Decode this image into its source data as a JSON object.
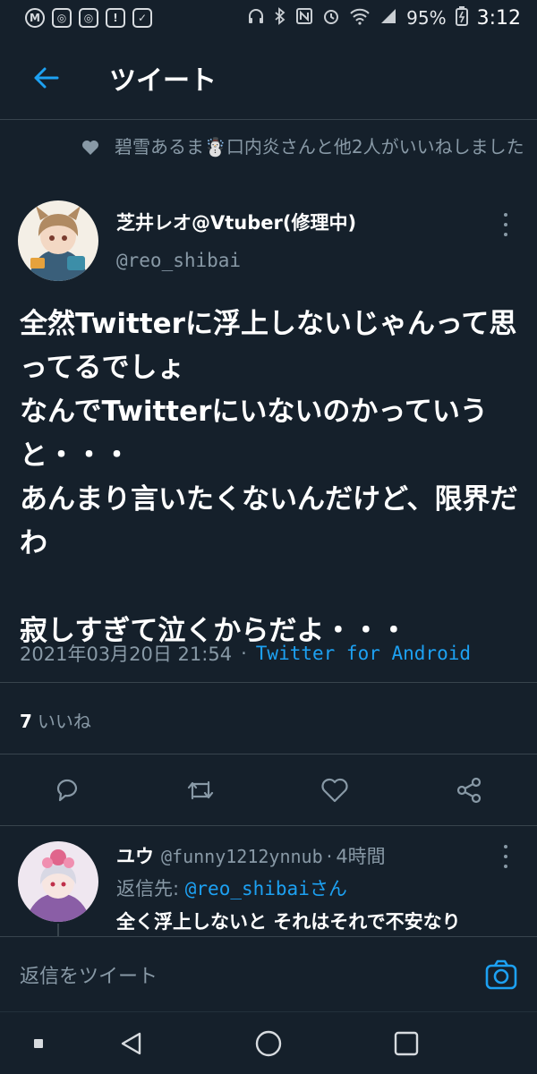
{
  "status_bar": {
    "left_icons": [
      "M",
      "◎",
      "◎",
      "!",
      "✓"
    ],
    "battery": "95%",
    "time": "3:12"
  },
  "header": {
    "title": "ツイート"
  },
  "social_context": {
    "text": "碧雪あるま☃️口内炎さんと他2人がいいねしました"
  },
  "tweet": {
    "author_name": "芝井レオ@Vtuber(修理中)",
    "author_handle": "@reo_shibai",
    "text": "全然Twitterに浮上しないじゃんって思ってるでしょ\nなんでTwitterにいないのかっていうと・・・\nあんまり言いたくないんだけど、限界だわ\n\n寂しすぎて泣くからだよ・・・",
    "timestamp": "2021年03月20日 21:54",
    "separator": "·",
    "source": "Twitter for Android",
    "like_count": "7",
    "like_label": "いいね"
  },
  "reply": {
    "name": "ユウ",
    "handle": "@funny1212ynnub",
    "dot": "·",
    "time": "4時間",
    "replying_to_prefix": "返信先: ",
    "replying_to_handle": "@reo_shibai",
    "replying_to_suffix": "さん",
    "text": "全く浮上しないと それはそれで不安なり"
  },
  "composer": {
    "placeholder": "返信をツイート"
  },
  "colors": {
    "background": "#15202b",
    "accent": "#1da1f2",
    "secondary_text": "#8899a6",
    "divider": "#38444d"
  }
}
